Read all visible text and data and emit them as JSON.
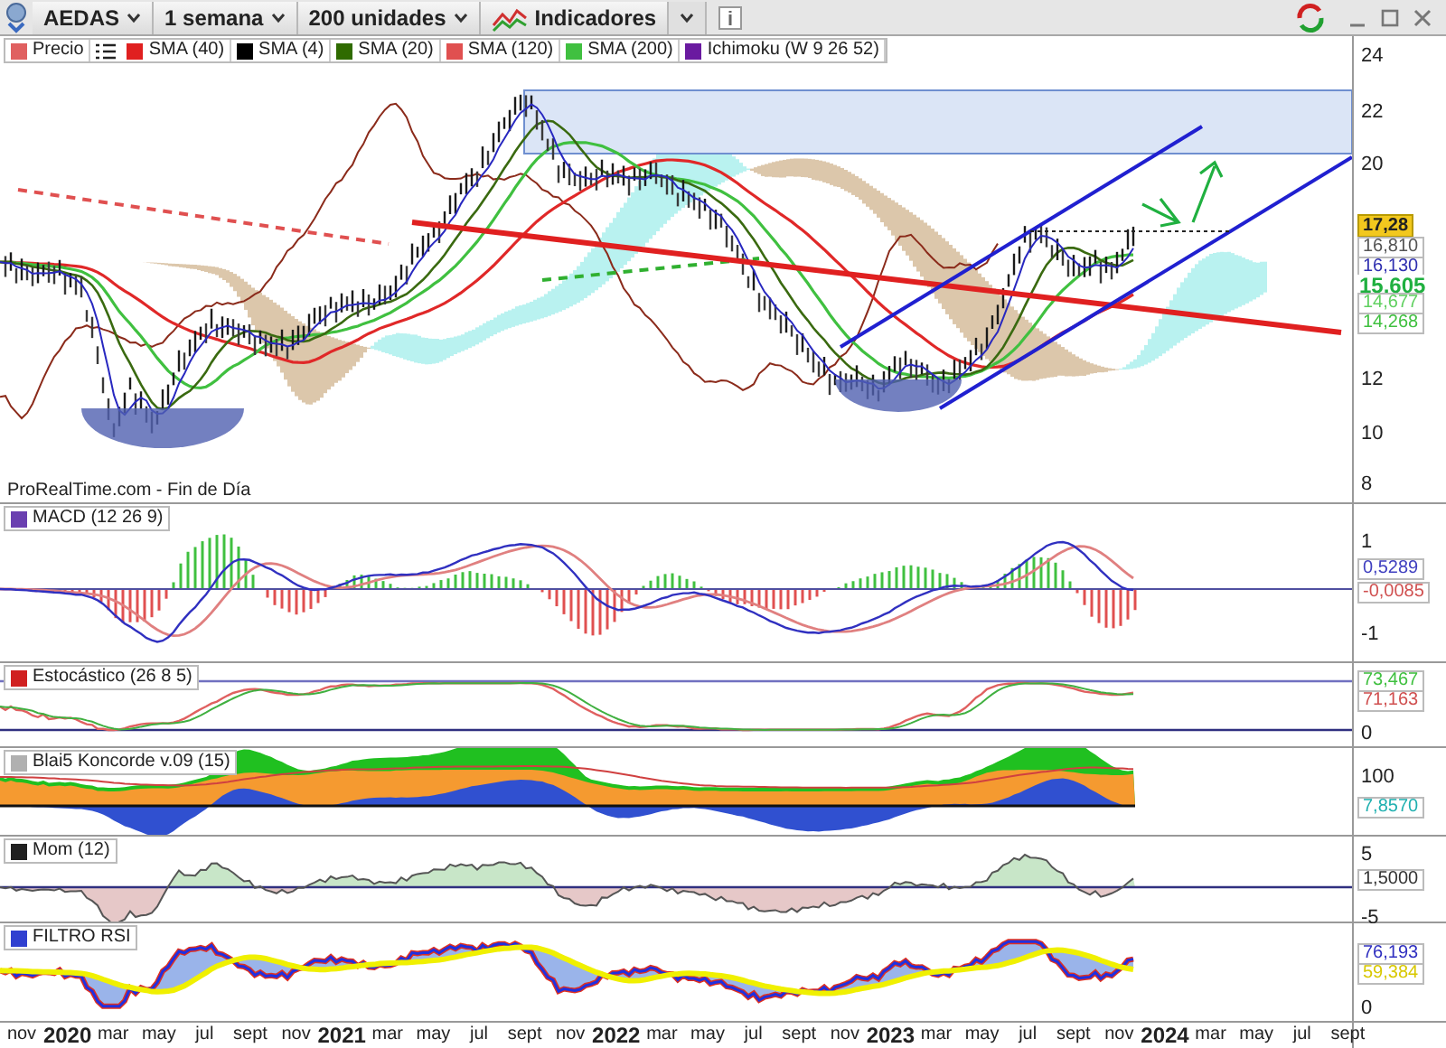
{
  "toolbar": {
    "instrument": "AEDAS",
    "timeframe": "1 semana",
    "units": "200 unidades",
    "indicators": "Indicadores"
  },
  "legend": [
    {
      "label": "Precio",
      "color": "#e06060"
    },
    {
      "label": "SMA (40)",
      "color": "#e02020"
    },
    {
      "label": "SMA (4)",
      "color": "#000000"
    },
    {
      "label": "SMA (20)",
      "color": "#2f6b00"
    },
    {
      "label": "SMA (120)",
      "color": "#e05050"
    },
    {
      "label": "SMA (200)",
      "color": "#40c040"
    },
    {
      "label": "Ichimoku (W 9 26 52)",
      "color": "#6a1aa0"
    }
  ],
  "source": "ProRealTime.com - Fin de Día",
  "price_axis": [
    {
      "text": "24",
      "kind": "tick"
    },
    {
      "text": "22",
      "kind": "tick"
    },
    {
      "text": "20",
      "kind": "tick"
    },
    {
      "text": "17,28",
      "kind": "highlight",
      "color": "#f2c81e"
    },
    {
      "text": "16,810",
      "kind": "tag",
      "color": "#555555"
    },
    {
      "text": "16,130",
      "kind": "tag",
      "color": "#3030b0"
    },
    {
      "text": "15,605",
      "kind": "current",
      "color": "#20b040"
    },
    {
      "text": "14,677",
      "kind": "tag",
      "color": "#60d060"
    },
    {
      "text": "14,268",
      "kind": "tag",
      "color": "#40c040"
    },
    {
      "text": "12",
      "kind": "tick"
    },
    {
      "text": "10",
      "kind": "tick"
    },
    {
      "text": "8",
      "kind": "tick"
    }
  ],
  "panels": [
    {
      "kind": "macd",
      "label": "MACD (12 26 9)",
      "color": "#6a3fb0",
      "axis": [
        {
          "text": "1",
          "kind": "tick"
        },
        {
          "text": "0,5289",
          "kind": "tag",
          "color": "#4040c0"
        },
        {
          "text": "-0,0085",
          "kind": "tag",
          "color": "#d05050"
        },
        {
          "text": "-1",
          "kind": "tick"
        }
      ]
    },
    {
      "kind": "stochastic",
      "label": "Estocástico (26 8 5)",
      "color": "#d02020",
      "axis": [
        {
          "text": "73,467",
          "kind": "tag",
          "color": "#40c040"
        },
        {
          "text": "71,163",
          "kind": "tag",
          "color": "#d05050"
        },
        {
          "text": "0",
          "kind": "tick"
        }
      ]
    },
    {
      "kind": "koncorde",
      "label": "Blai5 Koncorde v.09 (15)",
      "color": "#b0b0b0",
      "axis": [
        {
          "text": "100",
          "kind": "tick"
        },
        {
          "text": "7,8570",
          "kind": "tag",
          "color": "#20b0b0"
        }
      ]
    },
    {
      "kind": "momentum",
      "label": "Mom (12)",
      "color": "#202020",
      "axis": [
        {
          "text": "5",
          "kind": "tick"
        },
        {
          "text": "1,5000",
          "kind": "tag",
          "color": "#333333"
        },
        {
          "text": "-5",
          "kind": "tick"
        }
      ]
    },
    {
      "kind": "rsi",
      "label": "FILTRO RSI",
      "color": "#3040d0",
      "axis": [
        {
          "text": "76,193",
          "kind": "tag",
          "color": "#3030c0"
        },
        {
          "text": "59,384",
          "kind": "tag",
          "color": "#d8c800"
        },
        {
          "text": "0",
          "kind": "tick"
        }
      ]
    }
  ],
  "time_axis": [
    {
      "text": "nov",
      "kind": "month"
    },
    {
      "text": "2020",
      "kind": "year"
    },
    {
      "text": "mar",
      "kind": "month"
    },
    {
      "text": "may",
      "kind": "month"
    },
    {
      "text": "jul",
      "kind": "month"
    },
    {
      "text": "sept",
      "kind": "month"
    },
    {
      "text": "nov",
      "kind": "month"
    },
    {
      "text": "2021",
      "kind": "year"
    },
    {
      "text": "mar",
      "kind": "month"
    },
    {
      "text": "may",
      "kind": "month"
    },
    {
      "text": "jul",
      "kind": "month"
    },
    {
      "text": "sept",
      "kind": "month"
    },
    {
      "text": "nov",
      "kind": "month"
    },
    {
      "text": "2022",
      "kind": "year"
    },
    {
      "text": "mar",
      "kind": "month"
    },
    {
      "text": "may",
      "kind": "month"
    },
    {
      "text": "jul",
      "kind": "month"
    },
    {
      "text": "sept",
      "kind": "month"
    },
    {
      "text": "nov",
      "kind": "month"
    },
    {
      "text": "2023",
      "kind": "year"
    },
    {
      "text": "mar",
      "kind": "month"
    },
    {
      "text": "may",
      "kind": "month"
    },
    {
      "text": "jul",
      "kind": "month"
    },
    {
      "text": "sept",
      "kind": "month"
    },
    {
      "text": "nov",
      "kind": "month"
    },
    {
      "text": "2024",
      "kind": "year"
    },
    {
      "text": "mar",
      "kind": "month"
    },
    {
      "text": "may",
      "kind": "month"
    },
    {
      "text": "jul",
      "kind": "month"
    },
    {
      "text": "sept",
      "kind": "month"
    }
  ]
}
